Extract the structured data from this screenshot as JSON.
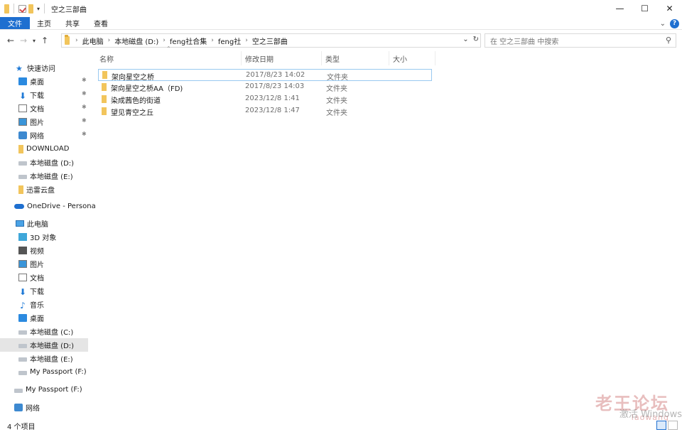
{
  "window": {
    "title": "空之三部曲",
    "controls": {
      "minimize": "—",
      "maximize": "☐",
      "close": "✕"
    }
  },
  "ribbon": {
    "tabs": [
      "文件",
      "主页",
      "共享",
      "查看"
    ],
    "help": "?"
  },
  "address": {
    "crumbs": [
      "此电脑",
      "本地磁盘 (D:)",
      "feng社合集",
      "feng社",
      "空之三部曲"
    ],
    "search_placeholder": "在 空之三部曲 中搜索"
  },
  "sidebar": {
    "quick_access": "快速访问",
    "quick_items": [
      {
        "label": "桌面",
        "pinned": true
      },
      {
        "label": "下载",
        "pinned": true
      },
      {
        "label": "文档",
        "pinned": true
      },
      {
        "label": "图片",
        "pinned": true
      },
      {
        "label": "网络",
        "pinned": true
      },
      {
        "label": "DOWNLOAD"
      },
      {
        "label": "本地磁盘 (D:)"
      },
      {
        "label": "本地磁盘 (E:)"
      },
      {
        "label": "迅雷云盘"
      }
    ],
    "onedrive": "OneDrive - Persona",
    "this_pc": "此电脑",
    "pc_items": [
      "3D 对象",
      "视频",
      "图片",
      "文档",
      "下载",
      "音乐",
      "桌面",
      "本地磁盘 (C:)",
      "本地磁盘 (D:)",
      "本地磁盘 (E:)",
      "My Passport (F:)"
    ],
    "passport": "My Passport (F:)",
    "network": "网络"
  },
  "columns": {
    "name": "名称",
    "date": "修改日期",
    "type": "类型",
    "size": "大小"
  },
  "files": [
    {
      "name": "架向星空之桥",
      "date": "2017/8/23 14:02",
      "type": "文件夹"
    },
    {
      "name": "架向星空之桥AA（FD)",
      "date": "2017/8/23 14:03",
      "type": "文件夹"
    },
    {
      "name": "染成茜色的街道",
      "date": "2023/12/8 1:41",
      "type": "文件夹"
    },
    {
      "name": "望见青空之丘",
      "date": "2023/12/8 1:47",
      "type": "文件夹"
    }
  ],
  "status": {
    "count": "4 个项目"
  },
  "watermark": {
    "forum": "老王论坛",
    "site": "laowang",
    "activate": "激活 Windows"
  }
}
